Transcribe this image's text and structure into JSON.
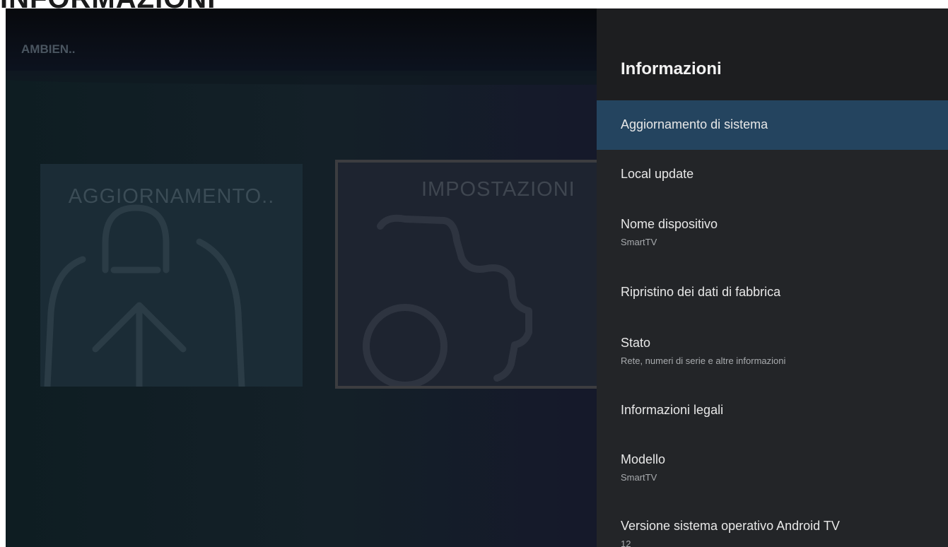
{
  "page_heading": "INFORMAZIONI",
  "background": {
    "ambient_label": "AMBIEN..",
    "tiles": [
      {
        "title": "AGGIORNAMENTO..",
        "icon": "bag-upload-icon"
      },
      {
        "title": "IMPOSTAZIONI",
        "icon": "gear-icon"
      }
    ]
  },
  "panel": {
    "title": "Informazioni",
    "items": [
      {
        "label": "Aggiornamento di sistema",
        "sub": "",
        "selected": true
      },
      {
        "label": "Local update",
        "sub": ""
      },
      {
        "label": "Nome dispositivo",
        "sub": "SmartTV"
      },
      {
        "label": "Ripristino dei dati di fabbrica",
        "sub": ""
      },
      {
        "label": "Stato",
        "sub": "Rete, numeri di serie e altre informazioni"
      },
      {
        "label": "Informazioni legali",
        "sub": ""
      },
      {
        "label": "Modello",
        "sub": "SmartTV"
      },
      {
        "label": "Versione sistema operativo Android TV",
        "sub": "12"
      }
    ]
  },
  "colors": {
    "selected_item": "#24445f",
    "panel_background": "#232528",
    "panel_header": "#1d1e20"
  }
}
